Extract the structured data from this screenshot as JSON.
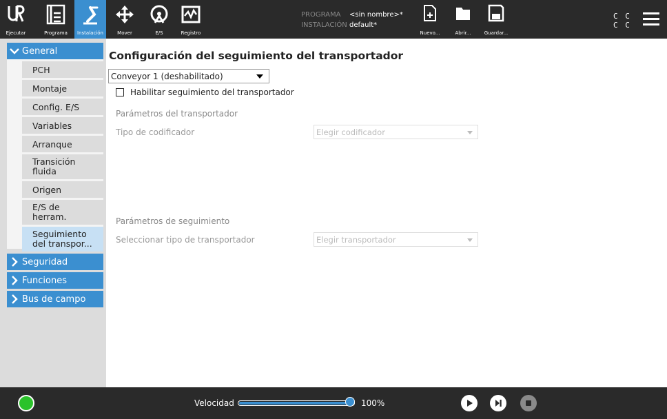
{
  "header": {
    "nav": [
      {
        "id": "run",
        "label": "Ejecutar",
        "icon": "ur-logo-icon"
      },
      {
        "id": "program",
        "label": "Programa",
        "icon": "program-tree-icon"
      },
      {
        "id": "installation",
        "label": "Instalación",
        "icon": "robot-arm-icon",
        "active": true
      },
      {
        "id": "move",
        "label": "Mover",
        "icon": "move-arrows-icon"
      },
      {
        "id": "io",
        "label": "E/S",
        "icon": "io-gauge-icon"
      },
      {
        "id": "log",
        "label": "Registro",
        "icon": "log-chart-icon"
      }
    ],
    "program_key": "PROGRAMA",
    "program_value": "<sin nombre>*",
    "installation_key": "INSTALACIÓN",
    "installation_value": "default*",
    "file_actions": [
      {
        "label": "Nuevo...",
        "icon": "new-file-icon"
      },
      {
        "label": "Abrir...",
        "icon": "open-folder-icon"
      },
      {
        "label": "Guardar...",
        "icon": "save-icon"
      }
    ],
    "cc_line1": "C C",
    "cc_line2": "C C"
  },
  "sidebar": {
    "sections": [
      {
        "label": "General",
        "expanded": true,
        "items": [
          {
            "label": "PCH"
          },
          {
            "label": "Montaje"
          },
          {
            "label": "Config. E/S"
          },
          {
            "label": "Variables"
          },
          {
            "label": "Arranque"
          },
          {
            "label": "Transición fluida"
          },
          {
            "label": "Origen"
          },
          {
            "label": "E/S de herram."
          },
          {
            "label": "Seguimiento del transpor...",
            "active": true
          }
        ]
      },
      {
        "label": "Seguridad",
        "expanded": false
      },
      {
        "label": "Funciones",
        "expanded": false
      },
      {
        "label": "Bus de campo",
        "expanded": false
      }
    ]
  },
  "main": {
    "title": "Configuración del seguimiento del transportador",
    "conveyor_select": "Conveyor 1 (deshabilitado)",
    "enable_label": "Habilitar seguimiento del transportador",
    "enable_checked": false,
    "conveyor_params_title": "Parámetros del transportador",
    "encoder_type_label": "Tipo de codificador",
    "encoder_select": "Elegir codificador",
    "tracking_params_title": "Parámetros de seguimiento",
    "conveyor_type_label": "Seleccionar tipo de transportador",
    "conveyor_type_select": "Elegir transportador"
  },
  "footer": {
    "speed_label": "Velocidad",
    "speed_value": "100%",
    "speed_fraction": 1.0,
    "power_color": "#2bc22b"
  },
  "colors": {
    "accent": "#3b8fd0",
    "header_bg": "#2a2a2a",
    "active_item": "#c7e0f4"
  }
}
